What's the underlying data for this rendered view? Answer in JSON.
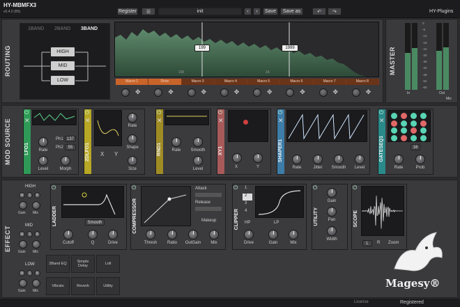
{
  "header": {
    "app_name": "HY-MBMFX3",
    "version": "v0.4.0 (B5)",
    "register": "Register",
    "preset": "init",
    "save": "Save",
    "save_as": "Save as",
    "brand": "HY-Plugins"
  },
  "routing": {
    "label": "ROUTING",
    "tabs": [
      "1BAND",
      "2BAND",
      "3BAND"
    ],
    "bands": [
      "HIGH",
      "MID",
      "LOW"
    ],
    "markers": [
      "199",
      "1999"
    ],
    "freq_labels": [
      "100",
      "1K"
    ],
    "macros": [
      "Macro 1",
      "Drive",
      "Macro 3",
      "Macro 4",
      "Macro 5",
      "Macro 6",
      "Macro 7",
      "Macro 8"
    ]
  },
  "master": {
    "label": "MASTER",
    "scale": [
      "0",
      "-6",
      "-12",
      "-18",
      "-24",
      "-30",
      "-36",
      "-42",
      "-48",
      "-54",
      "-60"
    ],
    "in": "In",
    "out": "Out",
    "mix": "Mix"
  },
  "mod_source": {
    "label": "MOD SOURCE",
    "lfo1": {
      "name": "LFO1",
      "ph1_label": "Ph1",
      "ph1": "137",
      "ph2_label": "Ph2",
      "ph2": "55",
      "knobs": [
        "Rate",
        "Level",
        "Morph"
      ]
    },
    "xdlfo1": {
      "name": "2DLFO1",
      "knobs": [
        "Rate",
        "Shape",
        "Size"
      ],
      "x": "X",
      "y": "Y"
    },
    "rnd1": {
      "name": "RND1",
      "knobs": [
        "Rate",
        "Smooth",
        "Level"
      ]
    },
    "xy1": {
      "name": "XY1",
      "x": "X",
      "y": "Y"
    },
    "shaper1": {
      "name": "SHAPER1",
      "knobs": [
        "Rate",
        "Jitter",
        "Smooth",
        "Level"
      ]
    },
    "gateseq1": {
      "name": "GATESEQ1",
      "steps": "16",
      "knobs": [
        "Rate",
        "Prob"
      ]
    }
  },
  "effect": {
    "label": "EFFECT",
    "bands": [
      {
        "name": "HIGH"
      },
      {
        "name": "MID"
      },
      {
        "name": "LOW"
      }
    ],
    "msb": [
      "M",
      "S",
      "B"
    ],
    "gain": "Gain",
    "mix": "Mix",
    "ladder": {
      "name": "LADDER",
      "smooth": "Smooth",
      "knobs": [
        "Cutoff",
        "Q",
        "Drive"
      ]
    },
    "compressor": {
      "name": "COMPRESSOR",
      "attack": "Attack",
      "release": "Release",
      "makeup": "Makeup",
      "knobs": [
        "Thresh",
        "Ratio",
        "OutGain",
        "Mix"
      ]
    },
    "clipper": {
      "name": "CLIPPER",
      "modes": [
        "1",
        "2",
        "3",
        "4"
      ],
      "hp": "HP",
      "lp": "LP",
      "knobs": [
        "Drive",
        "Gain",
        "Mix"
      ]
    },
    "utility": {
      "name": "UTILITY",
      "knobs": [
        "Gain",
        "Pan",
        "Width"
      ]
    },
    "scope": {
      "name": "SCOPE",
      "l": "L",
      "r": "R",
      "zoom": "Zoom"
    },
    "mid_slots": [
      "3Band EQ",
      "Simple Delay",
      "Lofi"
    ],
    "low_slots": [
      "Vibrato",
      "Reverb",
      "Utility"
    ]
  },
  "footer": {
    "license": "License",
    "registered": "Registered"
  },
  "watermark": {
    "text": "Magesy®"
  },
  "colors": {
    "lfo": "#2f9a57",
    "xdlfo": "#b8a825",
    "rnd": "#a08c25",
    "xy": "#a85a5a",
    "shaper": "#3d7da8",
    "gate": "#2a8a8a",
    "macro": "#c8642a",
    "meter": "#4a8a62"
  }
}
